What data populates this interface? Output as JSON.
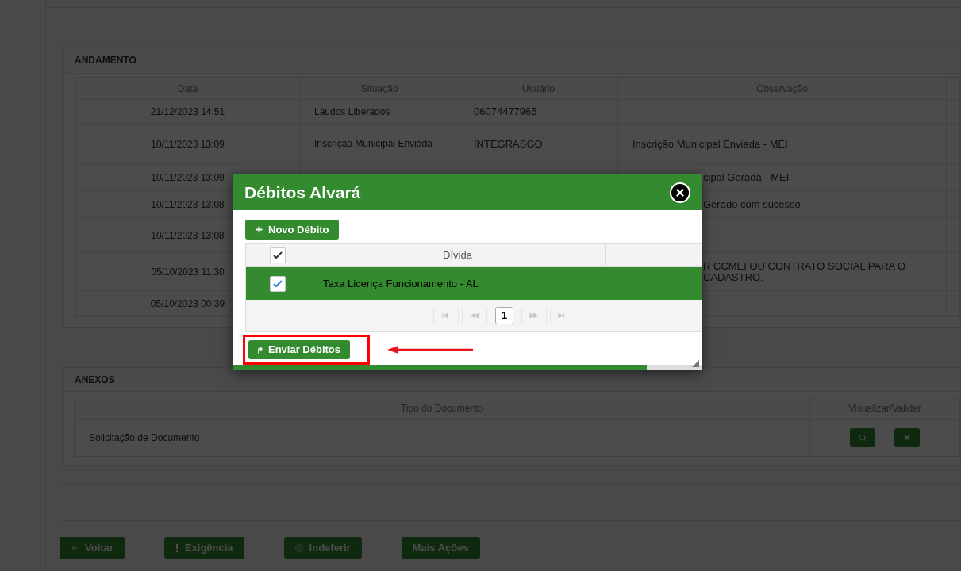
{
  "andamento": {
    "title": "ANDAMENTO",
    "columns": [
      "Data",
      "Situação",
      "Usuário",
      "Observação"
    ],
    "rows": [
      {
        "data": "21/12/2023 14:51",
        "situacao": "Laudos Liberados",
        "usuario": "06074477965"
      },
      {
        "data": "10/11/2023 13:09",
        "situacao": "Inscrição Municipal Enviada",
        "usuario": "INTEGRASGO",
        "observacao": {
          "text": "Inscrição Municipal Enviada - MEI"
        }
      },
      {
        "data": "10/11/2023 13:09",
        "observacao": {
          "text": "cipal Gerada - MEI",
          "clipped": true
        }
      },
      {
        "data": "10/11/2023 13:08",
        "observacao": {
          "text": "Gerado com sucesso",
          "clipped": true
        }
      },
      {
        "data": "10/11/2023 13:08"
      },
      {
        "data": "05/10/2023 11:30",
        "observacao": {
          "text": "R CCMEI OU CONTRATO SOCIAL PARA O CADASTRO.",
          "clipped": true
        }
      },
      {
        "data": "05/10/2023 00:39"
      }
    ]
  },
  "anexos": {
    "title": "ANEXOS",
    "columns": [
      "Tipo do Documento",
      "Visualizar/Validar"
    ],
    "rows": [
      {
        "tipo": "Solicitação de Documento"
      }
    ]
  },
  "actions": [
    {
      "kind": "back",
      "label": "Voltar"
    },
    {
      "kind": "alert",
      "label": "Exigência"
    },
    {
      "kind": "deny",
      "label": "Indeferir"
    },
    {
      "kind": "more",
      "label": "Mais Ações"
    }
  ],
  "modal": {
    "title": "Débitos Alvará",
    "new_button": "Novo Débito",
    "header_checked": true,
    "column": "Dívida",
    "rows": [
      {
        "checked": true,
        "selected": true,
        "divida": "Taxa Licença Funcionamento - AL"
      }
    ],
    "pages": [
      {
        "label": "1",
        "selected": true
      }
    ],
    "send_button": "Enviar Débitos"
  }
}
